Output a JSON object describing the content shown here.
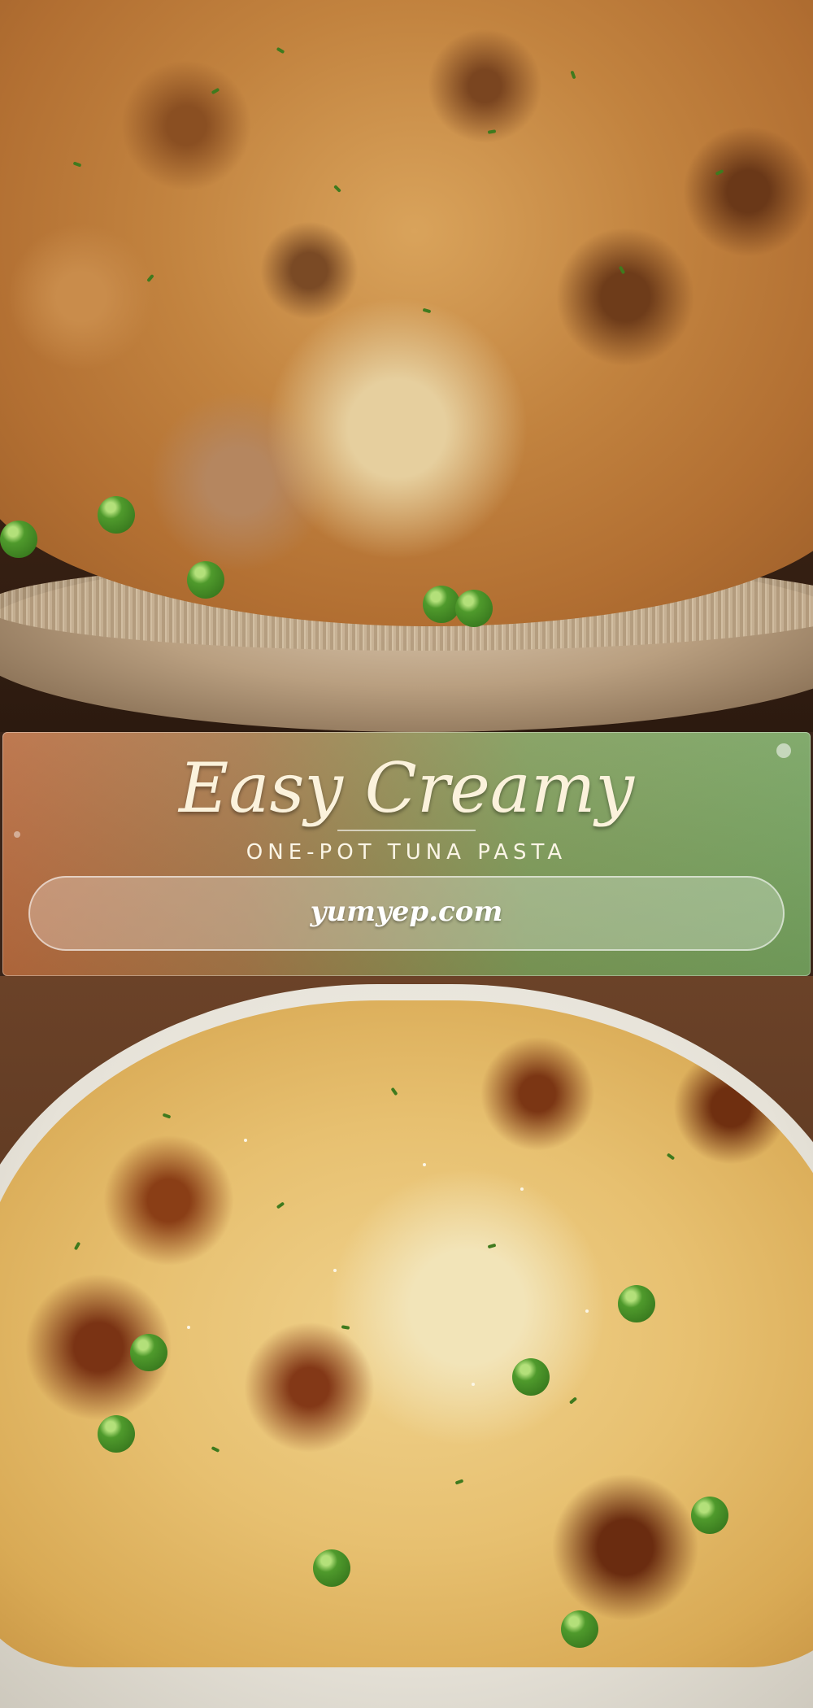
{
  "banner": {
    "title": "Easy Creamy",
    "subtitle": "ONE-POT TUNA PASTA",
    "website": "yumyep.com"
  },
  "colors": {
    "banner_gradient_start": "#b76a3d",
    "banner_gradient_end": "#74a15d",
    "title_text": "#fbf2dc"
  }
}
